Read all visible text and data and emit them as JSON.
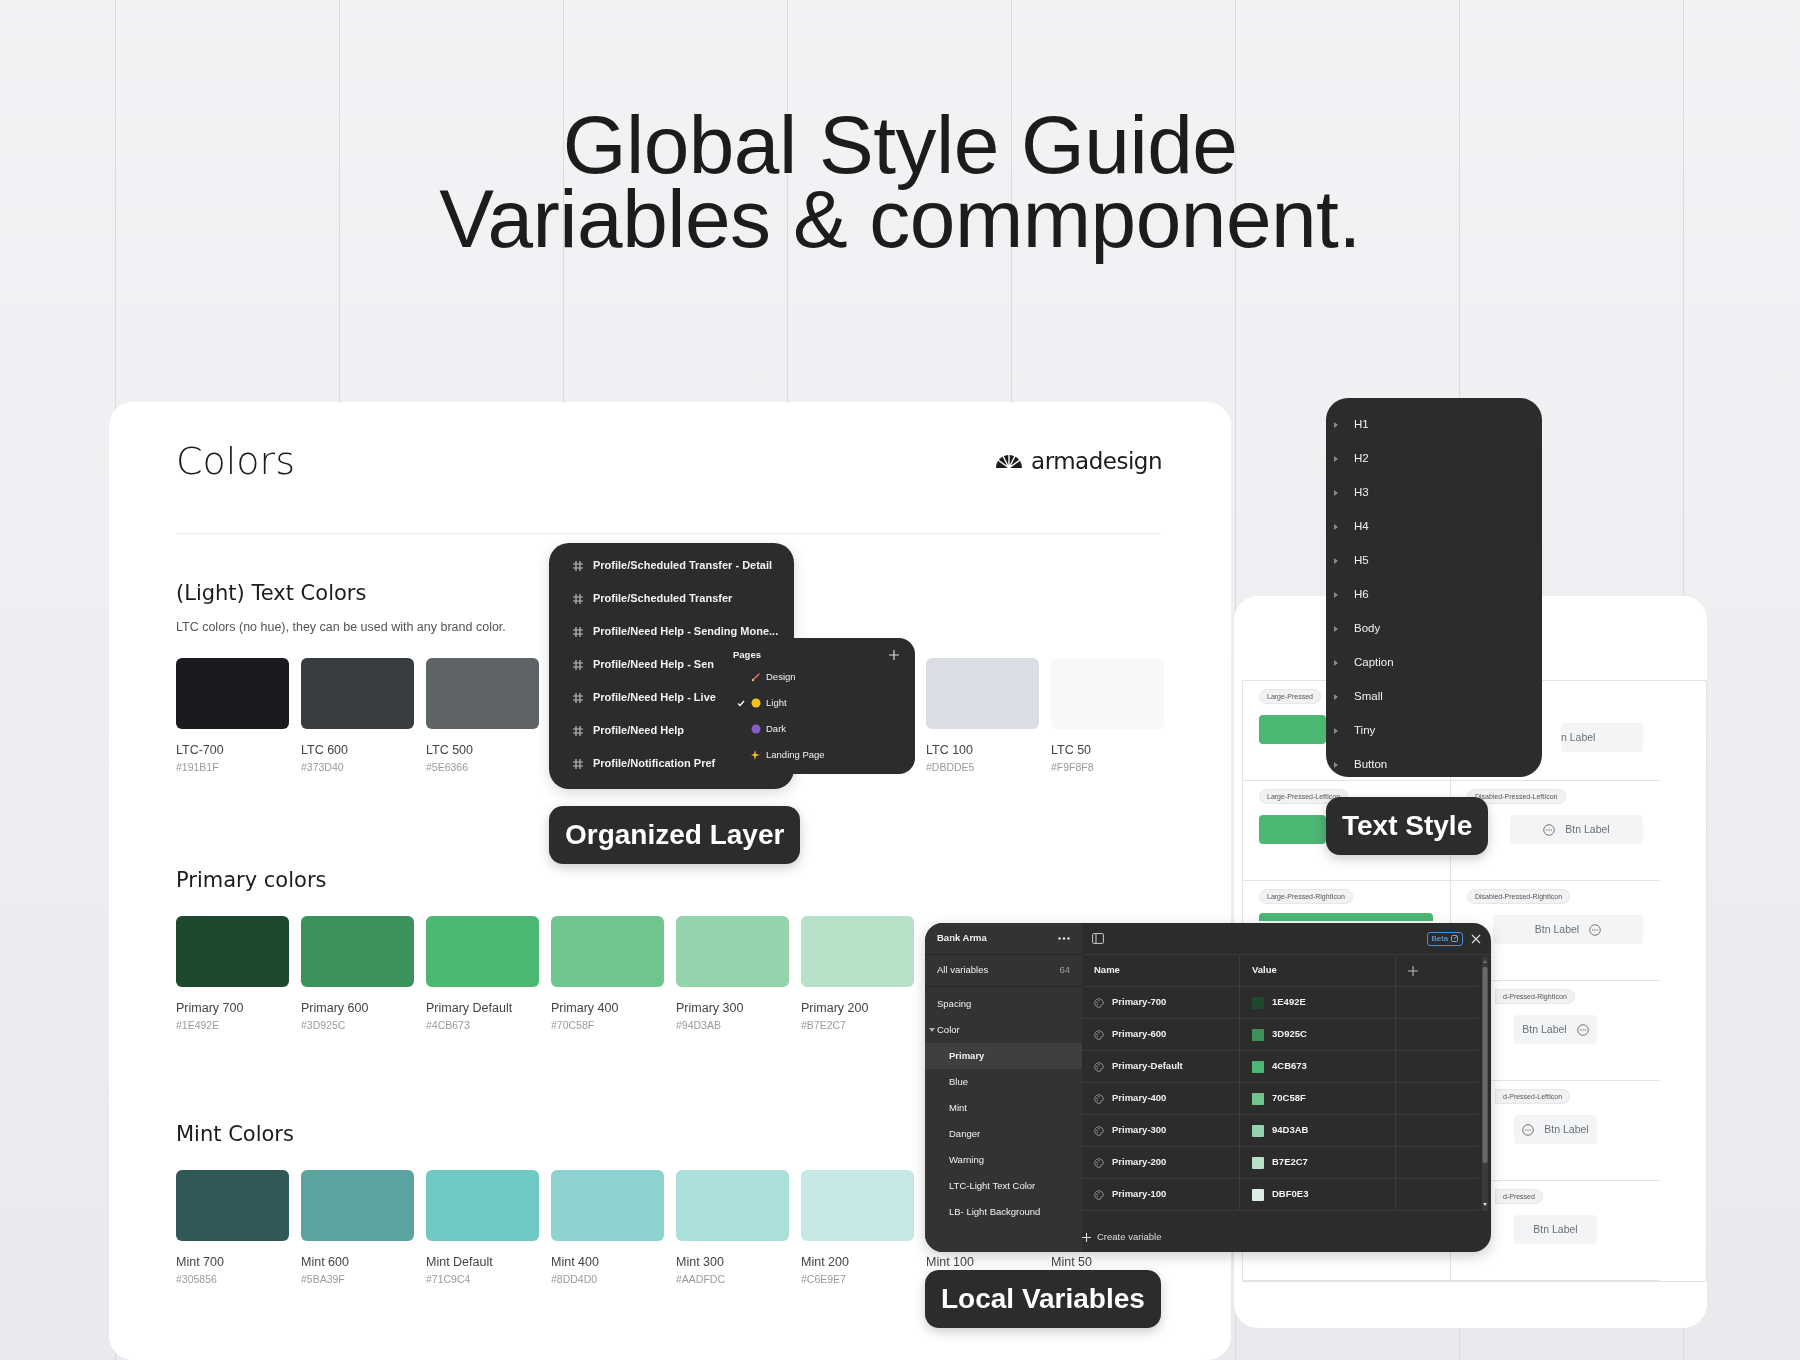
{
  "headline": [
    "Global Style Guide",
    "Variables & commponent."
  ],
  "colors_card": {
    "title": "Colors",
    "logo": "armadesign",
    "sections": [
      {
        "heading": "(Light) Text Colors",
        "description": "LTC colors (no hue), they can be used with any brand color.",
        "swatches": [
          {
            "name": "LTC-700",
            "hex": "#191B1F",
            "color": "#191b1f"
          },
          {
            "name": "LTC 600",
            "hex": "#373D40",
            "color": "#373d40"
          },
          {
            "name": "LTC 500",
            "hex": "#5E6366",
            "color": "#5e6366"
          },
          {
            "name": "LTC 100",
            "hex": "#DBDDE5",
            "color": "#dbdde5"
          },
          {
            "name": "LTC 50",
            "hex": "#F9F8F8",
            "color": "#f9f8f8"
          }
        ]
      },
      {
        "heading": "Primary colors",
        "swatches": [
          {
            "name": "Primary 700",
            "hex": "#1E492E",
            "color": "#1e492e"
          },
          {
            "name": "Primary 600",
            "hex": "#3D925C",
            "color": "#3d925c"
          },
          {
            "name": "Primary Default",
            "hex": "#4CB673",
            "color": "#4cb673"
          },
          {
            "name": "Primary 400",
            "hex": "#70C58F",
            "color": "#70c58f"
          },
          {
            "name": "Primary 300",
            "hex": "#94D3AB",
            "color": "#94d3ab"
          },
          {
            "name": "Primary 200",
            "hex": "#B7E2C7",
            "color": "#b7e2c7"
          }
        ]
      },
      {
        "heading": "Mint Colors",
        "swatches": [
          {
            "name": "Mint 700",
            "hex": "#305856",
            "color": "#305856"
          },
          {
            "name": "Mint 600",
            "hex": "#5BA39F",
            "color": "#5ba39f"
          },
          {
            "name": "Mint Default",
            "hex": "#71C9C4",
            "color": "#71c9c4"
          },
          {
            "name": "Mint 400",
            "hex": "#8DD4D0",
            "color": "#8dd4d0"
          },
          {
            "name": "Mint 300",
            "hex": "#AADFDC",
            "color": "#aadfdc"
          },
          {
            "name": "Mint 200",
            "hex": "#C6E9E7",
            "color": "#c6e9e7"
          },
          {
            "name": "Mint 100"
          },
          {
            "name": "Mint 50"
          }
        ]
      }
    ]
  },
  "layers_panel": {
    "items": [
      "Profile/Scheduled Transfer - Detail",
      "Profile/Scheduled Transfer",
      "Profile/Need Help - Sending Mone...",
      "Profile/Need Help - Sen",
      "Profile/Need Help - Live",
      "Profile/Need Help",
      "Profile/Notification Pref"
    ]
  },
  "pages_panel": {
    "title": "Pages",
    "items": [
      {
        "label": "Design",
        "kind": "rocket",
        "selected": false
      },
      {
        "label": "Light",
        "kind": "yellowdot",
        "selected": true
      },
      {
        "label": "Dark",
        "kind": "purpledot",
        "selected": false
      },
      {
        "label": "Landing Page",
        "kind": "sparkles",
        "selected": false
      }
    ]
  },
  "layers_label": "Organized Layer",
  "button_sheet": {
    "rows": [
      [
        {
          "tag": "Large-Pressed",
          "kind": "primary"
        },
        {
          "kind": "disabled",
          "label": "n Label"
        }
      ],
      [
        {
          "tag": "Large-Pressed-LeftIcon",
          "kind": "primary"
        },
        {
          "tag": "Disabled-Pressed-LeftIcon",
          "kind": "lefticon",
          "label": "Btn Label"
        }
      ],
      [
        {
          "tag": "Large-Pressed-RightIcon",
          "kind": "primary"
        },
        {
          "tag": "Disabled-Pressed-RightIcon",
          "kind": "righticon",
          "label": "Btn Label"
        }
      ],
      [
        {},
        {
          "tag": "d-Pressed-RightIcon",
          "kind": "righticon",
          "label": "Btn Label"
        }
      ],
      [
        {},
        {
          "tag": "d-Pressed-LeftIcon",
          "kind": "lefticon",
          "label": "Btn Label"
        }
      ],
      [
        {},
        {
          "tag": "d-Pressed",
          "kind": "disabled",
          "label": "Btn Label"
        }
      ]
    ]
  },
  "text_styles": {
    "items": [
      "H1",
      "H2",
      "H3",
      "H4",
      "H5",
      "H6",
      "Body",
      "Caption",
      "Small",
      "Tiny",
      "Button"
    ]
  },
  "text_style_label": "Text Style",
  "local_variables": {
    "collection": "Bank Arma",
    "badge": "Beta",
    "all_variables": {
      "label": "All variables",
      "count": "64"
    },
    "groups": [
      {
        "label": "Spacing"
      },
      {
        "label": "Color",
        "expanded": true,
        "children": [
          {
            "label": "Primary",
            "selected": true
          },
          {
            "label": "Blue",
            "selected": false
          },
          {
            "label": "Mint",
            "selected": false
          },
          {
            "label": "Danger",
            "selected": false
          },
          {
            "label": "Warning",
            "selected": false
          },
          {
            "label": "LTC-Light Text Color",
            "selected": false
          },
          {
            "label": "LB- Light Background",
            "selected": false
          }
        ]
      }
    ],
    "columns": [
      "Name",
      "Value"
    ],
    "rows": [
      {
        "name": "Primary-700",
        "value": "1E492E",
        "color": "#1e492e"
      },
      {
        "name": "Primary-600",
        "value": "3D925C",
        "color": "#3d925c"
      },
      {
        "name": "Primary-Default",
        "value": "4CB673",
        "color": "#4cb673"
      },
      {
        "name": "Primary-400",
        "value": "70C58F",
        "color": "#70c58f"
      },
      {
        "name": "Primary-300",
        "value": "94D3AB",
        "color": "#94d3ab"
      },
      {
        "name": "Primary-200",
        "value": "B7E2C7",
        "color": "#b7e2c7"
      },
      {
        "name": "Primary-100",
        "value": "DBF0E3",
        "color": "#dbf0e3"
      }
    ],
    "footer": "Create variable"
  },
  "variables_label": "Local Variables"
}
